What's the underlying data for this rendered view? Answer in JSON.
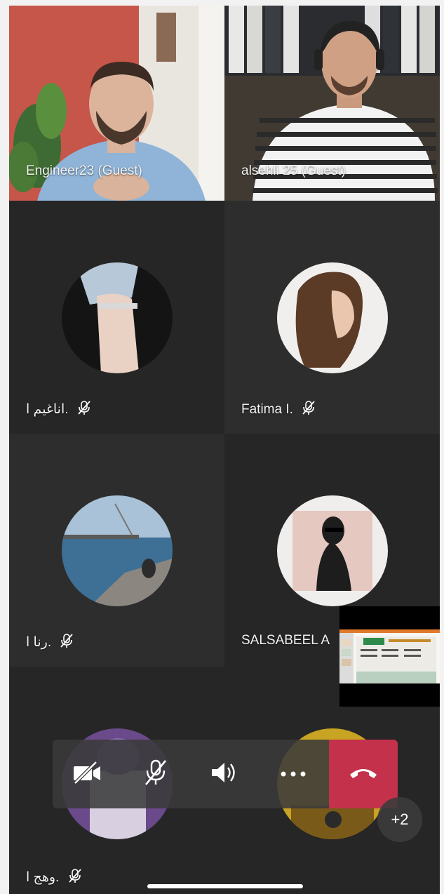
{
  "participants": {
    "p1": {
      "name": "Engineer23 (Guest)"
    },
    "p2": {
      "name": "alsehli 25 (Guest)"
    },
    "p3": {
      "name": "اناغيم ا."
    },
    "p4": {
      "name": "Fatima I."
    },
    "p5": {
      "name": "رنا ا."
    },
    "p6": {
      "name": "SALSABEEL A"
    },
    "p7": {
      "name": "وهج ا."
    }
  },
  "overflow_badge": "+2",
  "controls": {
    "camera": "camera-off-icon",
    "mic": "mic-off-icon",
    "speaker": "speaker-icon",
    "more": "more-icon",
    "hangup": "hang-up-icon"
  },
  "colors": {
    "tile_dark": "#262626",
    "hangup_red": "#c4314b",
    "control_bar": "#3a3a3a"
  }
}
